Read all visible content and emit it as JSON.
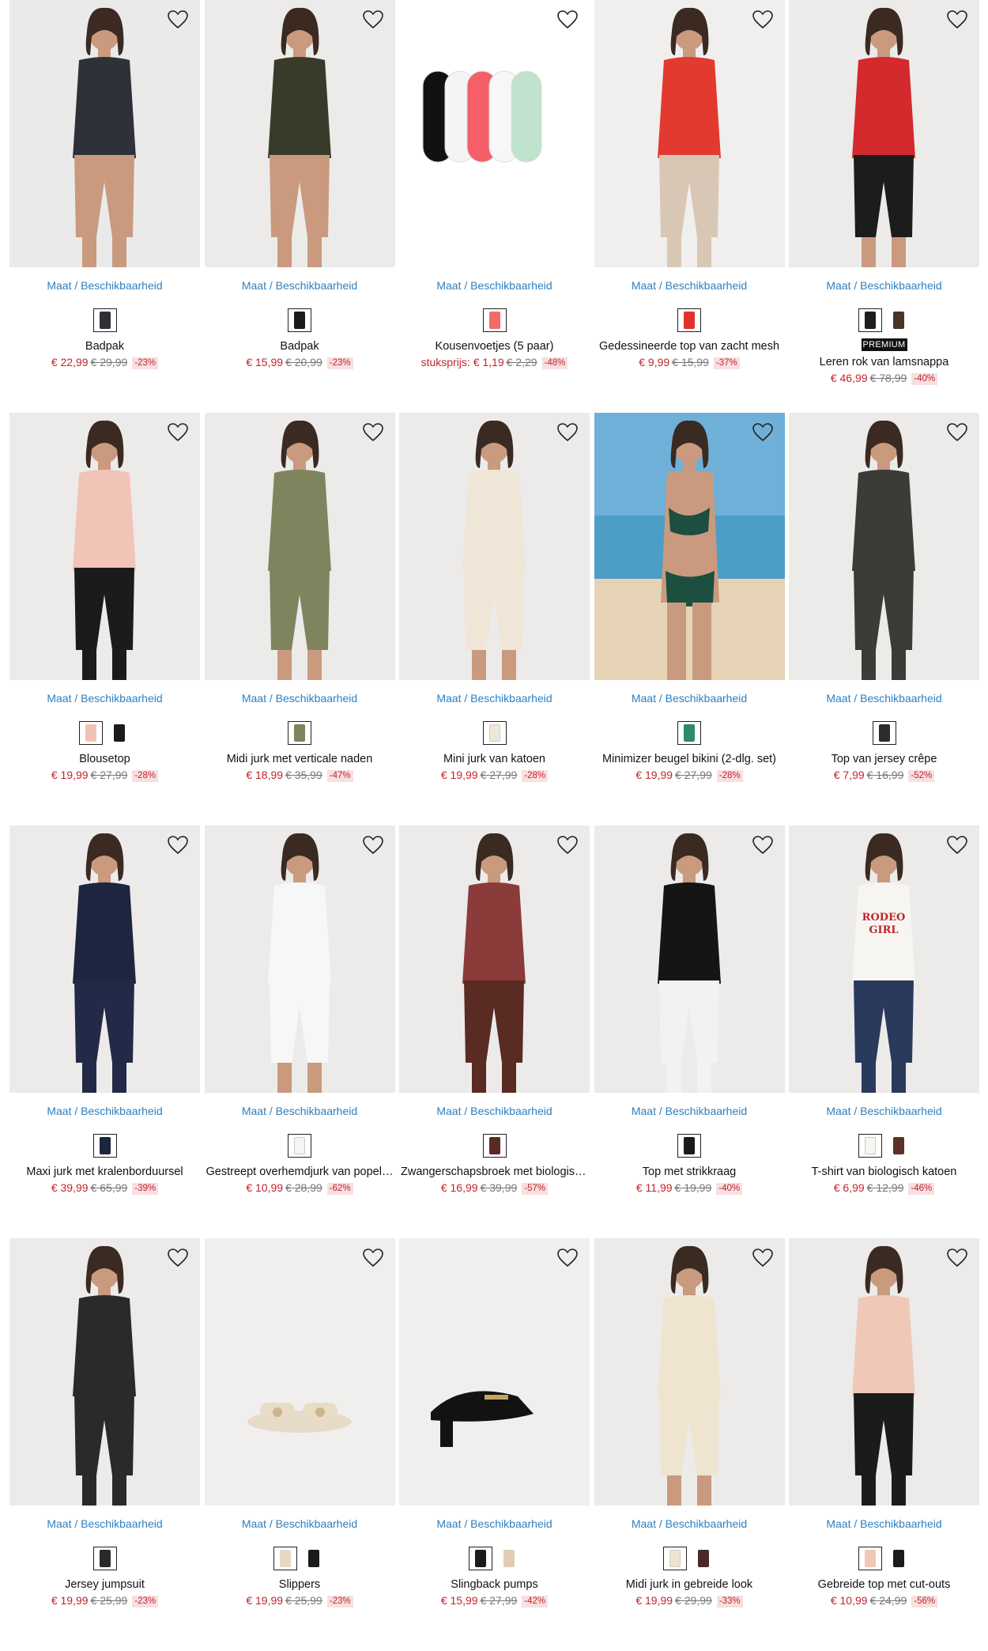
{
  "size_link_label": "Maat / Beschikbaarheid",
  "colors": {
    "price": "#c0262d",
    "link": "#2e7fbf",
    "discount_bg": "#f8dfe0"
  },
  "products": [
    {
      "name": "Badpak",
      "price": "€ 22,99",
      "old_price": "€ 29,99",
      "discount": "-23%",
      "image": "swimsuit-diamond-print",
      "swatches": [
        "#2d3136"
      ],
      "img_bg": "#eaeaea"
    },
    {
      "name": "Badpak",
      "price": "€ 15,99",
      "old_price": "€ 20,99",
      "discount": "-23%",
      "image": "swimsuit-leopard",
      "swatches": [
        "#1b1b1b"
      ],
      "img_bg": "#ecebea"
    },
    {
      "name": "Kousenvoetjes (5 paar)",
      "unit_label": "stuksprijs:",
      "price": "€ 1,19",
      "old_price": "€ 2,29",
      "discount": "-48%",
      "image": "no-show-socks",
      "swatches": [
        "#f26b6b"
      ],
      "img_bg": "#ffffff"
    },
    {
      "name": "Gedessineerde top van zacht mesh",
      "price": "€ 9,99",
      "old_price": "€ 15,99",
      "discount": "-37%",
      "image": "red-mesh-top",
      "swatches": [
        "#e0322b"
      ],
      "img_bg": "#f0efee"
    },
    {
      "name": "Leren rok van lamsnappa",
      "premium": "PREMIUM",
      "price": "€ 46,99",
      "old_price": "€ 78,99",
      "discount": "-40%",
      "image": "leather-skirt",
      "swatches": [
        "#1e1e1e",
        "#4a3427"
      ],
      "img_bg": "#ecebea"
    },
    {
      "name": "Blousetop",
      "price": "€ 19,99",
      "old_price": "€ 27,99",
      "discount": "-28%",
      "image": "pink-blouse",
      "swatches": [
        "#f1c2b4",
        "#1b1b1b"
      ],
      "img_bg": "#ecebea"
    },
    {
      "name": "Midi jurk met verticale naden",
      "price": "€ 18,99",
      "old_price": "€ 35,99",
      "discount": "-47%",
      "image": "olive-midi-dress",
      "swatches": [
        "#7f845e"
      ],
      "img_bg": "#ecebea"
    },
    {
      "name": "Mini jurk van katoen",
      "price": "€ 19,99",
      "old_price": "€ 27,99",
      "discount": "-28%",
      "image": "cream-mini-dress",
      "swatches": [
        "#efe7da"
      ],
      "img_bg": "#ecebea"
    },
    {
      "name": "Minimizer beugel bikini (2-dlg. set)",
      "price": "€ 19,99",
      "old_price": "€ 27,99",
      "discount": "-28%",
      "image": "printed-bikini",
      "swatches": [
        "#2d8a6c"
      ],
      "img_bg": "#7fb9d6"
    },
    {
      "name": "Top van jersey crêpe",
      "price": "€ 7,99",
      "old_price": "€ 16,99",
      "discount": "-52%",
      "image": "printed-jersey-top",
      "swatches": [
        "#2c2c2c"
      ],
      "img_bg": "#ecebea"
    },
    {
      "name": "Maxi jurk met kralenborduursel",
      "price": "€ 39,99",
      "old_price": "€ 65,99",
      "discount": "-39%",
      "image": "navy-maxi-dress",
      "swatches": [
        "#1e2540"
      ],
      "img_bg": "#ecebea"
    },
    {
      "name": "Gestreept overhemdjurk van popeline",
      "price": "€ 10,99",
      "old_price": "€ 28,99",
      "discount": "-62%",
      "image": "white-shirt-dress",
      "swatches": [
        "#f5f5f5"
      ],
      "img_bg": "#ecebea"
    },
    {
      "name": "Zwangerschapsbroek met biologisch katoen",
      "price": "€ 16,99",
      "old_price": "€ 39,99",
      "discount": "-57%",
      "image": "brown-cargo-pants",
      "swatches": [
        "#5a2b22"
      ],
      "img_bg": "#ecebea"
    },
    {
      "name": "Top met strikkraag",
      "price": "€ 11,99",
      "old_price": "€ 19,99",
      "discount": "-40%",
      "image": "black-bow-top",
      "swatches": [
        "#1b1b1b"
      ],
      "img_bg": "#ecebea"
    },
    {
      "name": "T-shirt van biologisch katoen",
      "price": "€ 6,99",
      "old_price": "€ 12,99",
      "discount": "-46%",
      "image": "rodeo-girl-tshirt",
      "swatches": [
        "#f7f5f2",
        "#5a3228"
      ],
      "img_bg": "#ecebea"
    },
    {
      "name": "Jersey jumpsuit",
      "price": "€ 19,99",
      "old_price": "€ 25,99",
      "discount": "-23%",
      "image": "floral-jumpsuit",
      "swatches": [
        "#2b2a28"
      ],
      "img_bg": "#ecebea"
    },
    {
      "name": "Slippers",
      "price": "€ 19,99",
      "old_price": "€ 25,99",
      "discount": "-23%",
      "image": "beige-slides",
      "swatches": [
        "#e7d9c4",
        "#1b1b1b"
      ],
      "img_bg": "#f0efee"
    },
    {
      "name": "Slingback pumps",
      "price": "€ 15,99",
      "old_price": "€ 27,99",
      "discount": "-42%",
      "image": "black-slingback",
      "swatches": [
        "#1b1b1b",
        "#e2cdb2"
      ],
      "img_bg": "#f0efee"
    },
    {
      "name": "Midi jurk in gebreide look",
      "price": "€ 19,99",
      "old_price": "€ 29,99",
      "discount": "-33%",
      "image": "cream-knit-dress",
      "swatches": [
        "#efe4cf",
        "#4a2a24"
      ],
      "img_bg": "#ecebea"
    },
    {
      "name": "Gebreide top met cut-outs",
      "price": "€ 10,99",
      "old_price": "€ 24,99",
      "discount": "-56%",
      "image": "cutout-knit-top",
      "swatches": [
        "#efc8b8",
        "#1b1b1b"
      ],
      "img_bg": "#ecebea"
    }
  ]
}
